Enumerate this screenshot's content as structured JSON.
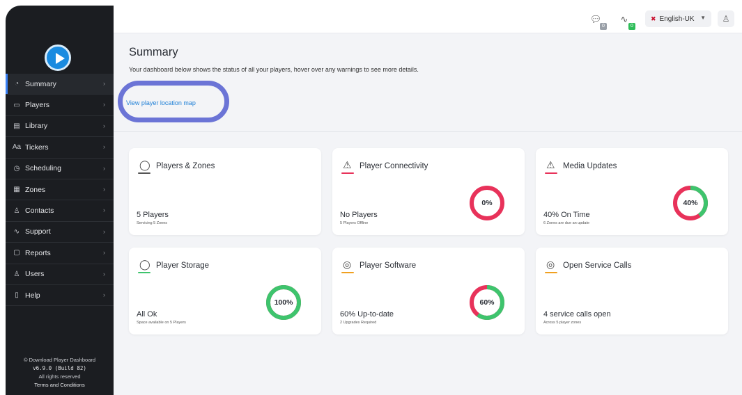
{
  "sidebar": {
    "logo": "play-logo",
    "items": [
      {
        "label": "Summary",
        "icon": "gauge-icon"
      },
      {
        "label": "Players",
        "icon": "player-device-icon"
      },
      {
        "label": "Library",
        "icon": "library-icon"
      },
      {
        "label": "Tickers",
        "icon": "text-icon"
      },
      {
        "label": "Scheduling",
        "icon": "clock-icon"
      },
      {
        "label": "Zones",
        "icon": "grid-icon"
      },
      {
        "label": "Contacts",
        "icon": "contacts-icon"
      },
      {
        "label": "Support",
        "icon": "pulse-icon"
      },
      {
        "label": "Reports",
        "icon": "report-icon"
      },
      {
        "label": "Users",
        "icon": "user-icon"
      },
      {
        "label": "Help",
        "icon": "help-icon"
      }
    ],
    "footer": {
      "copyright": "© Download Player Dashboard",
      "version": "v6.9.0 (Build 82)",
      "rights": "All rights reserved",
      "terms": "Terms and Conditions"
    }
  },
  "topbar": {
    "messages_badge": "0",
    "activity_badge": "0",
    "language": "English-UK"
  },
  "header": {
    "title": "Summary",
    "description": "Your dashboard below shows the status of all your players, hover over any warnings to see more details.",
    "map_button": "View player location map"
  },
  "cards": [
    {
      "title": "Players & Zones",
      "main": "5 Players",
      "sub": "Servicing 5 Zones",
      "icon": "check-circle-icon",
      "accent": "#555555",
      "percent": null,
      "percent_label": ""
    },
    {
      "title": "Player Connectivity",
      "main": "No Players",
      "sub": "5 Players Offline",
      "icon": "warning-icon",
      "accent": "#e8325a",
      "percent": 0,
      "percent_label": "0%"
    },
    {
      "title": "Media Updates",
      "main": "40% On Time",
      "sub": "6 Zones are due an update",
      "icon": "warning-icon",
      "accent": "#e8325a",
      "percent": 40,
      "percent_label": "40%"
    },
    {
      "title": "Player Storage",
      "main": "All Ok",
      "sub": "Space available on 5 Players",
      "icon": "check-circle-icon",
      "accent": "#3ec46d",
      "percent": 100,
      "percent_label": "100%"
    },
    {
      "title": "Player Software",
      "main": "60% Up-to-date",
      "sub": "2 Upgrades Required",
      "icon": "software-icon",
      "accent": "#f0a020",
      "percent": 60,
      "percent_label": "60%"
    },
    {
      "title": "Open Service Calls",
      "main": "4 service calls open",
      "sub": "Across 5 player zones",
      "icon": "software-icon",
      "accent": "#f0a020",
      "percent": null,
      "percent_label": ""
    }
  ],
  "colors": {
    "donut_good": "#3ec46d",
    "donut_bad": "#e8325a",
    "link": "#1e7fd6",
    "sidebar_bg": "#1b1d21"
  }
}
